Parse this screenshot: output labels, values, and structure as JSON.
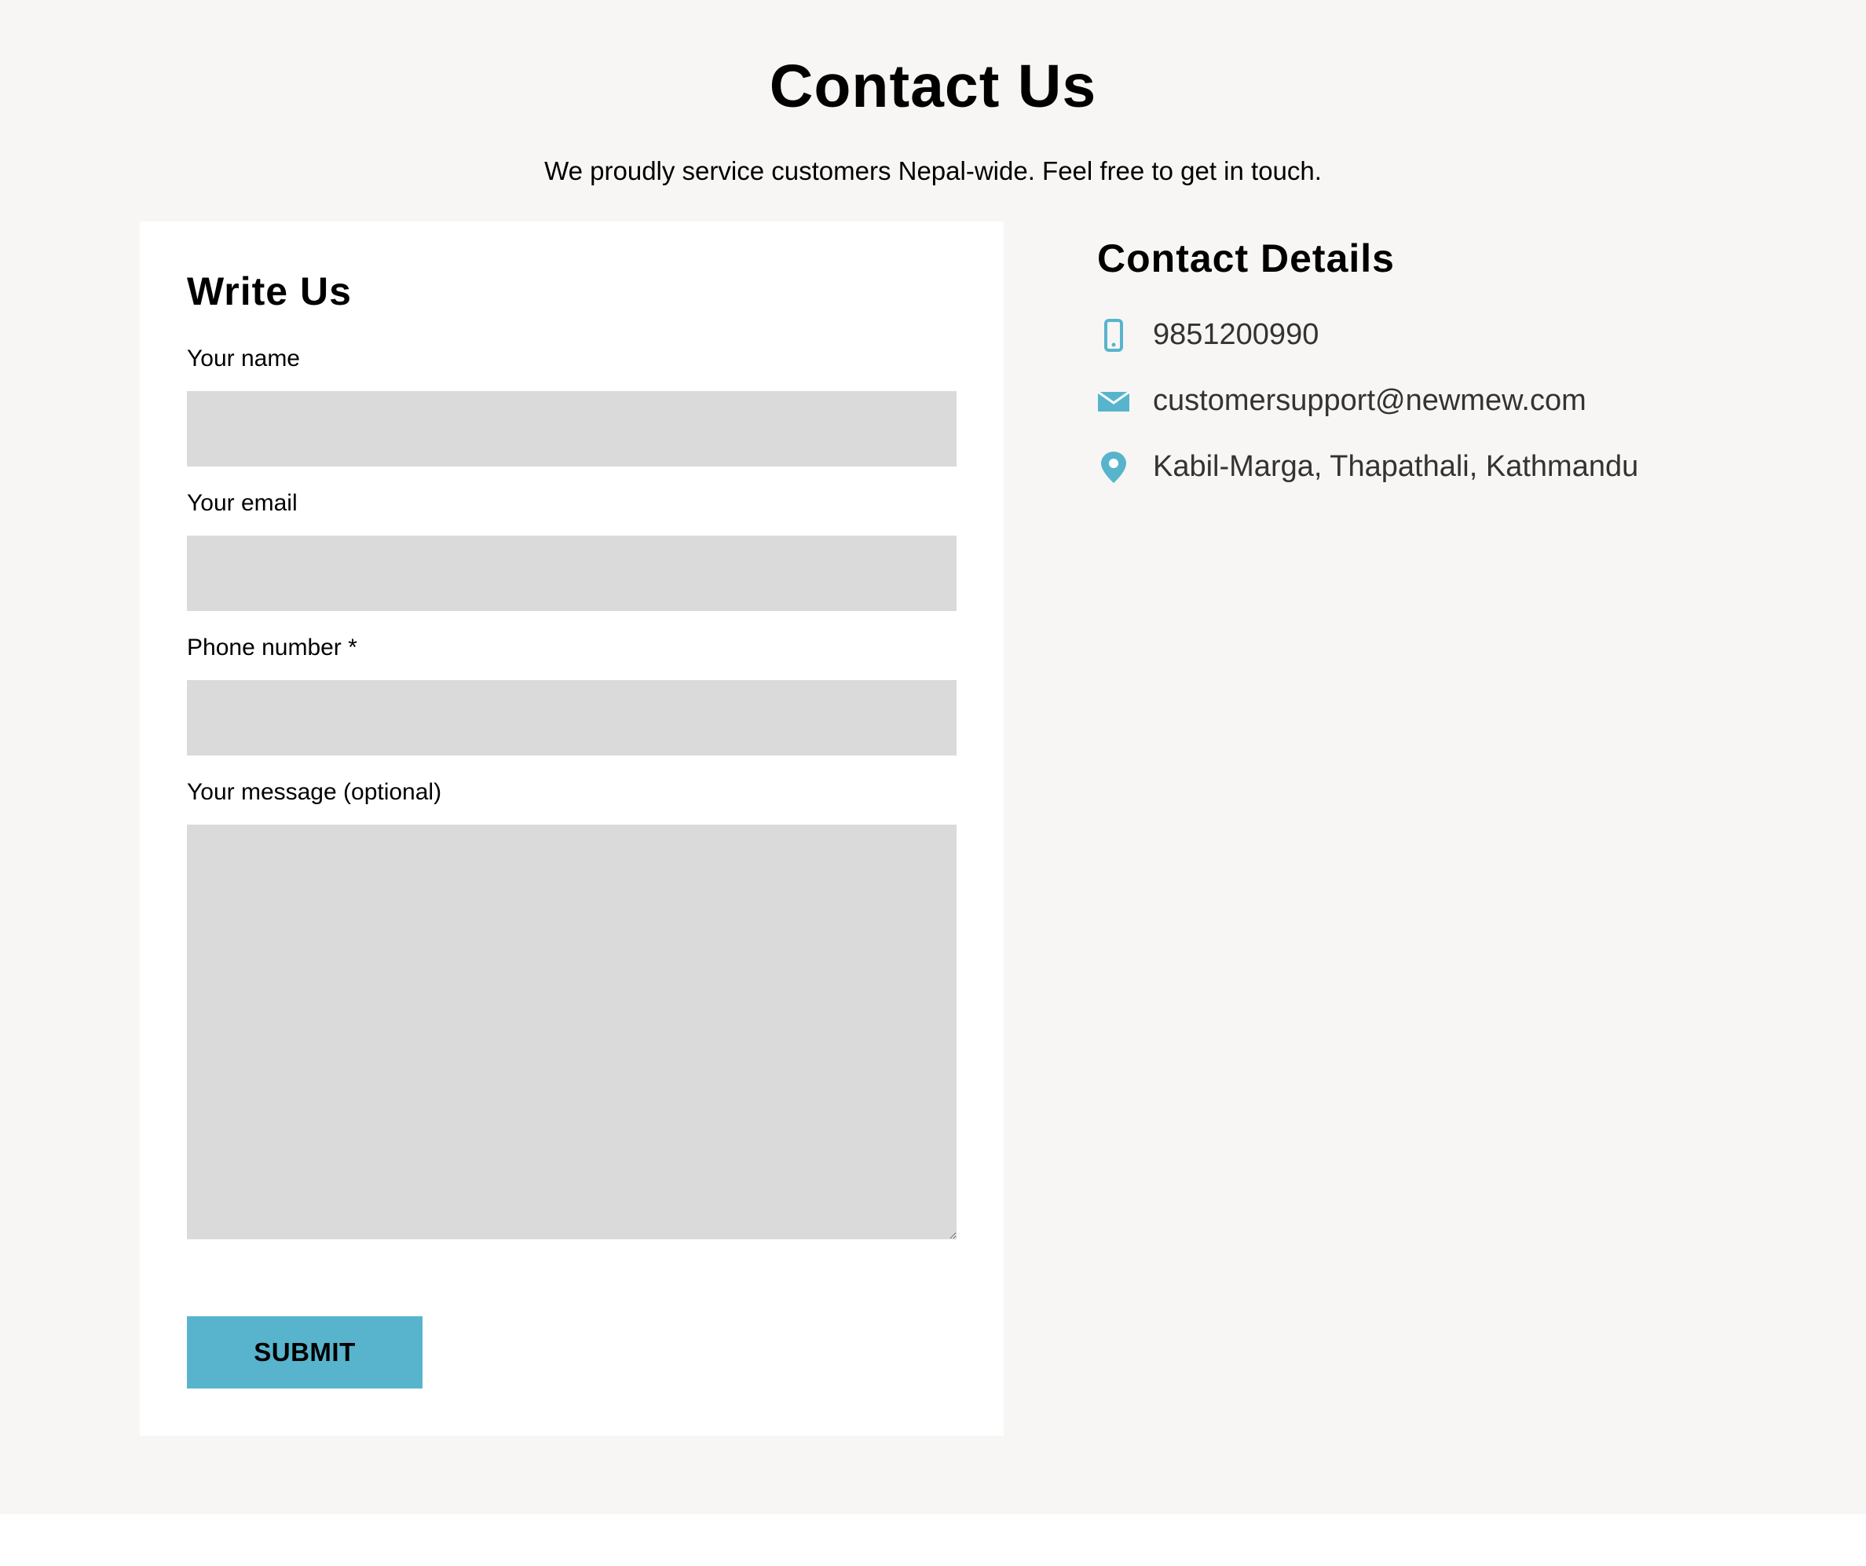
{
  "header": {
    "title": "Contact Us",
    "subtitle": "We proudly service customers Nepal-wide. Feel free to get in touch."
  },
  "form": {
    "title": "Write Us",
    "fields": [
      {
        "label": "Your name",
        "value": "",
        "placeholder": ""
      },
      {
        "label": "Your email",
        "value": "",
        "placeholder": ""
      },
      {
        "label": "Phone number *",
        "value": "",
        "placeholder": ""
      },
      {
        "label": "Your message (optional)",
        "value": "",
        "placeholder": ""
      }
    ],
    "submit_label": "SUBMIT"
  },
  "contact_details": {
    "title": "Contact Details",
    "items": [
      {
        "icon": "mobile-phone-icon",
        "text": "9851200990"
      },
      {
        "icon": "envelope-icon",
        "text": "customersupport@newmew.com"
      },
      {
        "icon": "map-pin-icon",
        "text": "Kabil-Marga, Thapathali, Kathmandu"
      }
    ]
  },
  "colors": {
    "accent": "#58b4cd",
    "page_background": "#f7f6f4",
    "input_background": "#dadada",
    "card_background": "#ffffff"
  }
}
